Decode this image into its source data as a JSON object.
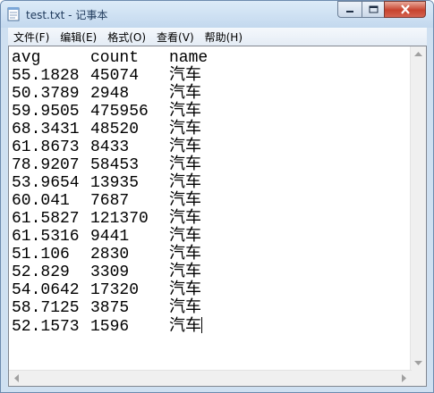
{
  "window": {
    "title": "test.txt - 记事本"
  },
  "menu": [
    {
      "label": "文件(F)"
    },
    {
      "label": "编辑(E)"
    },
    {
      "label": "格式(O)"
    },
    {
      "label": "查看(V)"
    },
    {
      "label": "帮助(H)"
    }
  ],
  "document": {
    "header": [
      "avg",
      "count",
      "name"
    ],
    "rows": [
      [
        "55.1828",
        "45074",
        "汽车"
      ],
      [
        "50.3789",
        "2948",
        "汽车"
      ],
      [
        "59.9505",
        "475956",
        "汽车"
      ],
      [
        "68.3431",
        "48520",
        "汽车"
      ],
      [
        "61.8673",
        "8433",
        "汽车"
      ],
      [
        "78.9207",
        "58453",
        "汽车"
      ],
      [
        "53.9654",
        "13935",
        "汽车"
      ],
      [
        "60.041",
        "7687",
        "汽车"
      ],
      [
        "61.5827",
        "121370",
        "汽车"
      ],
      [
        "61.5316",
        "9441",
        "汽车"
      ],
      [
        "51.106",
        "2830",
        "汽车"
      ],
      [
        "52.829",
        "3309",
        "汽车"
      ],
      [
        "54.0642",
        "17320",
        "汽车"
      ],
      [
        "58.7125",
        "3875",
        "汽车"
      ],
      [
        "52.1573",
        "1596",
        "汽车"
      ]
    ]
  }
}
